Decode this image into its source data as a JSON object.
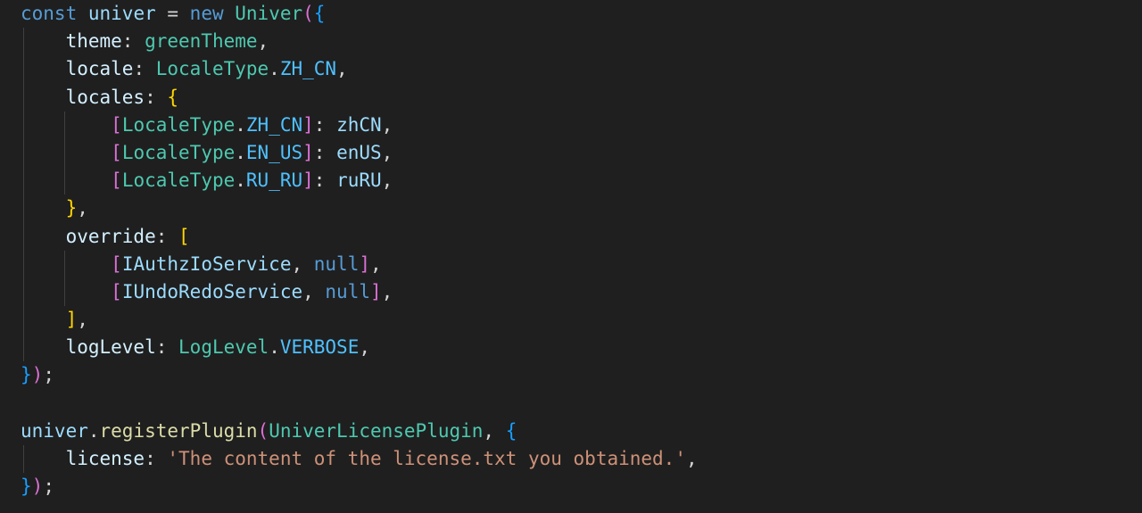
{
  "theme": {
    "background": "#1f1f1f",
    "indent_guide": "#404040",
    "colors": {
      "keyword": "#569cd6",
      "variable": "#9cdcfe",
      "property": "#d4f0ff",
      "type": "#4ec9b0",
      "function": "#dcdcaa",
      "string": "#ce9178",
      "punct": "#d4d4d4",
      "brace1": "#ffd700",
      "brace2": "#da70d6",
      "brace3": "#179fff",
      "constant": "#4fc1ff"
    }
  },
  "code": {
    "lines": [
      {
        "indent": 0,
        "guides": [],
        "tokens": [
          {
            "t": "const",
            "c": "keyword"
          },
          {
            "t": " ",
            "c": "punct"
          },
          {
            "t": "univer",
            "c": "variable"
          },
          {
            "t": " = ",
            "c": "punct"
          },
          {
            "t": "new",
            "c": "keyword"
          },
          {
            "t": " ",
            "c": "punct"
          },
          {
            "t": "Univer",
            "c": "type"
          },
          {
            "t": "(",
            "c": "brace2"
          },
          {
            "t": "{",
            "c": "brace3"
          }
        ]
      },
      {
        "indent": 1,
        "guides": [
          1
        ],
        "tokens": [
          {
            "t": "theme",
            "c": "property"
          },
          {
            "t": ": ",
            "c": "punct"
          },
          {
            "t": "greenTheme",
            "c": "type"
          },
          {
            "t": ",",
            "c": "punct"
          }
        ]
      },
      {
        "indent": 1,
        "guides": [
          1
        ],
        "tokens": [
          {
            "t": "locale",
            "c": "property"
          },
          {
            "t": ": ",
            "c": "punct"
          },
          {
            "t": "LocaleType",
            "c": "type"
          },
          {
            "t": ".",
            "c": "punct"
          },
          {
            "t": "ZH_CN",
            "c": "constant"
          },
          {
            "t": ",",
            "c": "punct"
          }
        ]
      },
      {
        "indent": 1,
        "guides": [
          1
        ],
        "tokens": [
          {
            "t": "locales",
            "c": "property"
          },
          {
            "t": ": ",
            "c": "punct"
          },
          {
            "t": "{",
            "c": "brace1"
          }
        ]
      },
      {
        "indent": 2,
        "guides": [
          1,
          2
        ],
        "tokens": [
          {
            "t": "[",
            "c": "brace2"
          },
          {
            "t": "LocaleType",
            "c": "type"
          },
          {
            "t": ".",
            "c": "punct"
          },
          {
            "t": "ZH_CN",
            "c": "constant"
          },
          {
            "t": "]",
            "c": "brace2"
          },
          {
            "t": ": ",
            "c": "punct"
          },
          {
            "t": "zhCN",
            "c": "variable"
          },
          {
            "t": ",",
            "c": "punct"
          }
        ]
      },
      {
        "indent": 2,
        "guides": [
          1,
          2
        ],
        "tokens": [
          {
            "t": "[",
            "c": "brace2"
          },
          {
            "t": "LocaleType",
            "c": "type"
          },
          {
            "t": ".",
            "c": "punct"
          },
          {
            "t": "EN_US",
            "c": "constant"
          },
          {
            "t": "]",
            "c": "brace2"
          },
          {
            "t": ": ",
            "c": "punct"
          },
          {
            "t": "enUS",
            "c": "variable"
          },
          {
            "t": ",",
            "c": "punct"
          }
        ]
      },
      {
        "indent": 2,
        "guides": [
          1,
          2
        ],
        "tokens": [
          {
            "t": "[",
            "c": "brace2"
          },
          {
            "t": "LocaleType",
            "c": "type"
          },
          {
            "t": ".",
            "c": "punct"
          },
          {
            "t": "RU_RU",
            "c": "constant"
          },
          {
            "t": "]",
            "c": "brace2"
          },
          {
            "t": ": ",
            "c": "punct"
          },
          {
            "t": "ruRU",
            "c": "variable"
          },
          {
            "t": ",",
            "c": "punct"
          }
        ]
      },
      {
        "indent": 1,
        "guides": [
          1
        ],
        "tokens": [
          {
            "t": "}",
            "c": "brace1"
          },
          {
            "t": ",",
            "c": "punct"
          }
        ]
      },
      {
        "indent": 1,
        "guides": [
          1
        ],
        "tokens": [
          {
            "t": "override",
            "c": "property"
          },
          {
            "t": ": ",
            "c": "punct"
          },
          {
            "t": "[",
            "c": "brace1"
          }
        ]
      },
      {
        "indent": 2,
        "guides": [
          1,
          2
        ],
        "tokens": [
          {
            "t": "[",
            "c": "brace2"
          },
          {
            "t": "IAuthzIoService",
            "c": "variable"
          },
          {
            "t": ", ",
            "c": "punct"
          },
          {
            "t": "null",
            "c": "keyword"
          },
          {
            "t": "]",
            "c": "brace2"
          },
          {
            "t": ",",
            "c": "punct"
          }
        ]
      },
      {
        "indent": 2,
        "guides": [
          1,
          2
        ],
        "tokens": [
          {
            "t": "[",
            "c": "brace2"
          },
          {
            "t": "IUndoRedoService",
            "c": "variable"
          },
          {
            "t": ", ",
            "c": "punct"
          },
          {
            "t": "null",
            "c": "keyword"
          },
          {
            "t": "]",
            "c": "brace2"
          },
          {
            "t": ",",
            "c": "punct"
          }
        ]
      },
      {
        "indent": 1,
        "guides": [
          1
        ],
        "tokens": [
          {
            "t": "]",
            "c": "brace1"
          },
          {
            "t": ",",
            "c": "punct"
          }
        ]
      },
      {
        "indent": 1,
        "guides": [
          1
        ],
        "tokens": [
          {
            "t": "logLevel",
            "c": "property"
          },
          {
            "t": ": ",
            "c": "punct"
          },
          {
            "t": "LogLevel",
            "c": "type"
          },
          {
            "t": ".",
            "c": "punct"
          },
          {
            "t": "VERBOSE",
            "c": "constant"
          },
          {
            "t": ",",
            "c": "punct"
          }
        ]
      },
      {
        "indent": 0,
        "guides": [],
        "tokens": [
          {
            "t": "}",
            "c": "brace3"
          },
          {
            "t": ")",
            "c": "brace2"
          },
          {
            "t": ";",
            "c": "punct"
          }
        ]
      },
      {
        "indent": 0,
        "guides": [],
        "tokens": []
      },
      {
        "indent": 0,
        "guides": [],
        "tokens": [
          {
            "t": "univer",
            "c": "variable"
          },
          {
            "t": ".",
            "c": "punct"
          },
          {
            "t": "registerPlugin",
            "c": "function"
          },
          {
            "t": "(",
            "c": "brace2"
          },
          {
            "t": "UniverLicensePlugin",
            "c": "type"
          },
          {
            "t": ", ",
            "c": "punct"
          },
          {
            "t": "{",
            "c": "brace3"
          }
        ]
      },
      {
        "indent": 1,
        "guides": [
          1
        ],
        "tokens": [
          {
            "t": "license",
            "c": "property"
          },
          {
            "t": ": ",
            "c": "punct"
          },
          {
            "t": "'The content of the license.txt you obtained.'",
            "c": "string"
          },
          {
            "t": ",",
            "c": "punct"
          }
        ]
      },
      {
        "indent": 0,
        "guides": [],
        "tokens": [
          {
            "t": "}",
            "c": "brace3"
          },
          {
            "t": ")",
            "c": "brace2"
          },
          {
            "t": ";",
            "c": "punct"
          }
        ]
      }
    ]
  }
}
